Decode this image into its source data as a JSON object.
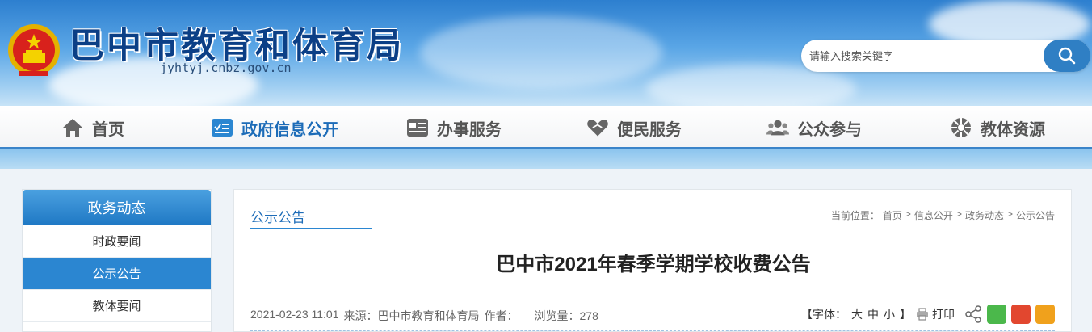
{
  "header": {
    "site_title": "巴中市教育和体育局",
    "site_domain": "jyhtyj.cnbz.gov.cn",
    "emblem_icon": "national-emblem-icon"
  },
  "search": {
    "placeholder": "请输入搜索关键字",
    "button_icon": "search-icon"
  },
  "nav": {
    "items": [
      {
        "label": "首页",
        "icon": "home-icon"
      },
      {
        "label": "政府信息公开",
        "icon": "info-public-icon",
        "active": true
      },
      {
        "label": "办事服务",
        "icon": "service-icon"
      },
      {
        "label": "便民服务",
        "icon": "heart-hand-icon"
      },
      {
        "label": "公众参与",
        "icon": "people-icon"
      },
      {
        "label": "教体资源",
        "icon": "resource-icon"
      }
    ]
  },
  "sidebar": {
    "title": "政务动态",
    "items": [
      {
        "label": "时政要闻"
      },
      {
        "label": "公示公告",
        "active": true
      },
      {
        "label": "教体要闻"
      }
    ]
  },
  "main": {
    "tab": "公示公告",
    "breadcrumb": {
      "prefix": "当前位置：",
      "items": [
        "首页",
        "信息公开",
        "政务动态",
        "公示公告"
      ],
      "separator": ">"
    },
    "article_title": "巴中市2021年春季学期学校收费公告",
    "meta": {
      "date": "2021-02-23 11:01",
      "source_label": "来源：",
      "source": "巴中市教育和体育局",
      "author_label": "作者：",
      "views_label": "浏览量：",
      "views": "278"
    },
    "tools": {
      "font_label": "【字体：",
      "large": "大",
      "medium": "中",
      "small": "小",
      "close_bracket": "】",
      "print_label": "打印"
    }
  },
  "colors": {
    "accent": "#2b86d1",
    "nav_active": "#1d6cb8",
    "title_blue": "#0b3f86"
  }
}
